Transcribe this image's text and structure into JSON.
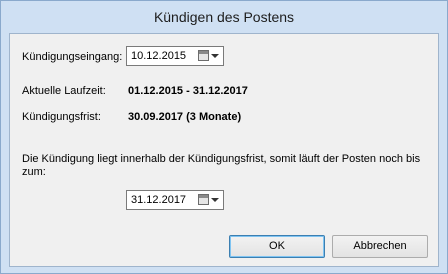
{
  "window": {
    "title": "Kündigen des Postens"
  },
  "form": {
    "eingang_label": "Kündigungseingang:",
    "eingang_value": "10.12.2015",
    "laufzeit_label": "Aktuelle Laufzeit:",
    "laufzeit_value": "01.12.2015 - 31.12.2017",
    "frist_label": "Kündigungsfrist:",
    "frist_value": "30.09.2017 (3 Monate)",
    "message_line1": "Die Kündigung liegt innerhalb der Kündigungsfrist, somit läuft der Posten noch bis",
    "message_line2": "zum:",
    "end_date_value": "31.12.2017"
  },
  "buttons": {
    "ok_label": "OK",
    "cancel_label": "Abbrechen"
  },
  "icons": {
    "calendar": "calendar-icon",
    "dropdown": "chevron-down-icon"
  }
}
